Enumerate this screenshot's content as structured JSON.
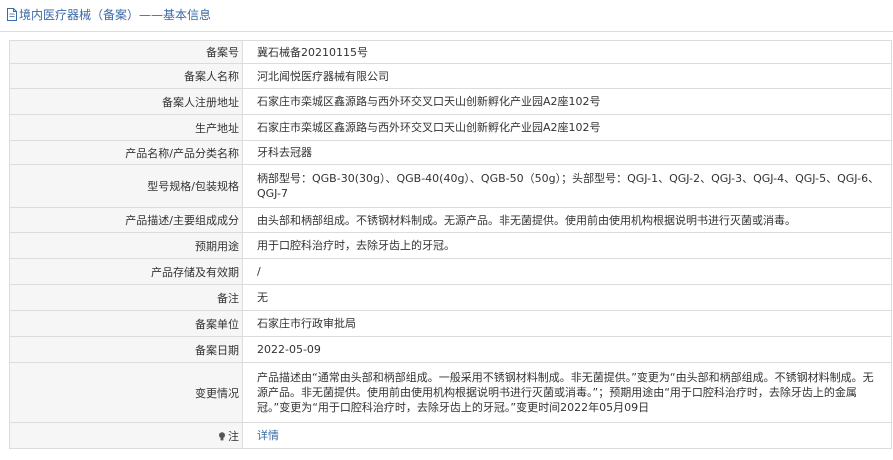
{
  "header": {
    "title": "境内医疗器械（备案）——基本信息"
  },
  "rows": [
    {
      "label": "备案号",
      "value": "冀石械备20210115号"
    },
    {
      "label": "备案人名称",
      "value": "河北闻悦医疗器械有限公司"
    },
    {
      "label": "备案人注册地址",
      "value": "石家庄市栾城区鑫源路与西外环交叉口天山创新孵化产业园A2座102号"
    },
    {
      "label": "生产地址",
      "value": "石家庄市栾城区鑫源路与西外环交叉口天山创新孵化产业园A2座102号"
    },
    {
      "label": "产品名称/产品分类名称",
      "value": "牙科去冠器"
    },
    {
      "label": "型号规格/包装规格",
      "value": "柄部型号：QGB-30(30g）、QGB-40(40g）、QGB-50（50g）；头部型号：QGJ-1、QGJ-2、QGJ-3、QGJ-4、QGJ-5、QGJ-6、QGJ-7"
    },
    {
      "label": "产品描述/主要组成成分",
      "value": "由头部和柄部组成。不锈钢材料制成。无源产品。非无菌提供。使用前由使用机构根据说明书进行灭菌或消毒。"
    },
    {
      "label": "预期用途",
      "value": "用于口腔科治疗时，去除牙齿上的牙冠。"
    },
    {
      "label": "产品存储及有效期",
      "value": "/"
    },
    {
      "label": "备注",
      "value": "无"
    },
    {
      "label": "备案单位",
      "value": "石家庄市行政审批局"
    },
    {
      "label": "备案日期",
      "value": "2022-05-09"
    },
    {
      "label": "变更情况",
      "value": "产品描述由“通常由头部和柄部组成。一般采用不锈钢材料制成。非无菌提供。”变更为“由头部和柄部组成。不锈钢材料制成。无源产品。非无菌提供。使用前由使用机构根据说明书进行灭菌或消毒。”；预期用途由“用于口腔科治疗时，去除牙齿上的金属冠。”变更为“用于口腔科治疗时，去除牙齿上的牙冠。”变更时间2022年05月09日"
    }
  ],
  "note": {
    "label": "注",
    "link": "详情"
  },
  "colors": {
    "link": "#3a6aa6",
    "label_bg": "#f6f6f6",
    "border": "#dcdcdc"
  }
}
